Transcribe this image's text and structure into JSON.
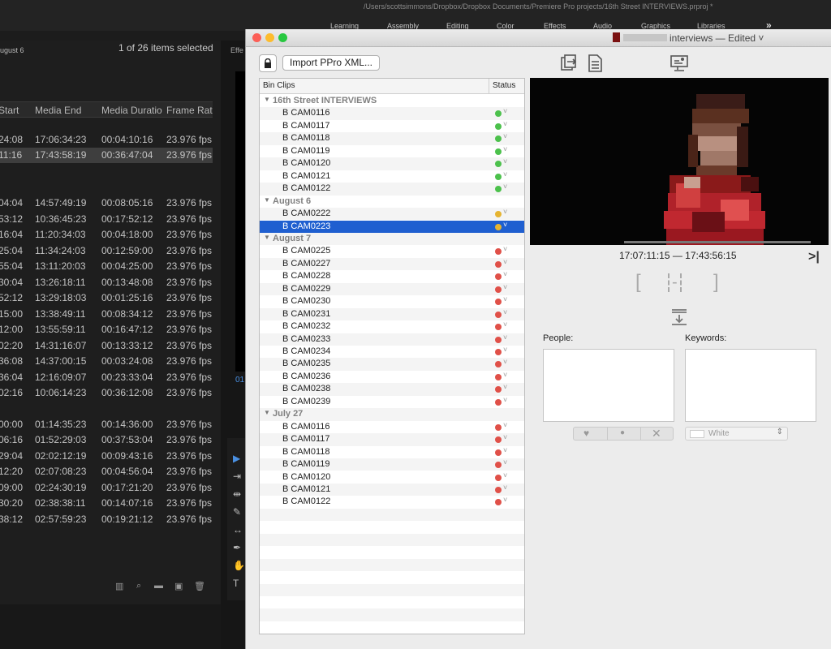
{
  "premiere": {
    "title_path": "/Users/scottsimmons/Dropbox/Dropbox Documents/Premiere Pro projects/16th Street INTERVIEWS.prproj *",
    "workspaces": [
      "Learning",
      "Assembly",
      "Editing",
      "Color",
      "Effects",
      "Audio",
      "Graphics",
      "Libraries"
    ],
    "more_label": "»",
    "panel_tab": "ugust 6",
    "selection_count": "1 of 26 items selected",
    "columns": [
      "Start",
      "Media End",
      "Media Duratio",
      "Frame Rat"
    ],
    "rows": [
      {
        "start": "24:08",
        "end": "17:06:34:23",
        "dur": "00:04:10:16",
        "fps": "23.976 fps"
      },
      {
        "start": "11:16",
        "end": "17:43:58:19",
        "dur": "00:36:47:04",
        "fps": "23.976 fps"
      },
      {
        "start": "04:04",
        "end": "14:57:49:19",
        "dur": "00:08:05:16",
        "fps": "23.976 fps"
      },
      {
        "start": "53:12",
        "end": "10:36:45:23",
        "dur": "00:17:52:12",
        "fps": "23.976 fps"
      },
      {
        "start": "16:04",
        "end": "11:20:34:03",
        "dur": "00:04:18:00",
        "fps": "23.976 fps"
      },
      {
        "start": "25:04",
        "end": "11:34:24:03",
        "dur": "00:12:59:00",
        "fps": "23.976 fps"
      },
      {
        "start": "55:04",
        "end": "13:11:20:03",
        "dur": "00:04:25:00",
        "fps": "23.976 fps"
      },
      {
        "start": "30:04",
        "end": "13:26:18:11",
        "dur": "00:13:48:08",
        "fps": "23.976 fps"
      },
      {
        "start": "52:12",
        "end": "13:29:18:03",
        "dur": "00:01:25:16",
        "fps": "23.976 fps"
      },
      {
        "start": "15:00",
        "end": "13:38:49:11",
        "dur": "00:08:34:12",
        "fps": "23.976 fps"
      },
      {
        "start": "12:00",
        "end": "13:55:59:11",
        "dur": "00:16:47:12",
        "fps": "23.976 fps"
      },
      {
        "start": "02:20",
        "end": "14:31:16:07",
        "dur": "00:13:33:12",
        "fps": "23.976 fps"
      },
      {
        "start": "36:08",
        "end": "14:37:00:15",
        "dur": "00:03:24:08",
        "fps": "23.976 fps"
      },
      {
        "start": "36:04",
        "end": "12:16:09:07",
        "dur": "00:23:33:04",
        "fps": "23.976 fps"
      },
      {
        "start": "02:16",
        "end": "10:06:14:23",
        "dur": "00:36:12:08",
        "fps": "23.976 fps"
      },
      {
        "start": "00:00",
        "end": "01:14:35:23",
        "dur": "00:14:36:00",
        "fps": "23.976 fps"
      },
      {
        "start": "06:16",
        "end": "01:52:29:03",
        "dur": "00:37:53:04",
        "fps": "23.976 fps"
      },
      {
        "start": "29:04",
        "end": "02:02:12:19",
        "dur": "00:09:43:16",
        "fps": "23.976 fps"
      },
      {
        "start": "12:20",
        "end": "02:07:08:23",
        "dur": "00:04:56:04",
        "fps": "23.976 fps"
      },
      {
        "start": "09:00",
        "end": "02:24:30:19",
        "dur": "00:17:21:20",
        "fps": "23.976 fps"
      },
      {
        "start": "30:20",
        "end": "02:38:38:11",
        "dur": "00:14:07:16",
        "fps": "23.976 fps"
      },
      {
        "start": "38:12",
        "end": "02:57:59:23",
        "dur": "00:19:21:12",
        "fps": "23.976 fps"
      }
    ],
    "effects_tab": "Effe",
    "timecode_fragment": "01"
  },
  "app": {
    "title": "interviews — Edited ˅",
    "import_label": "Import PPro XML...",
    "bin_header": "Bin Clips",
    "status_header": "Status",
    "status_colors": {
      "green": "#4cc14c",
      "yellow": "#e6b431",
      "red": "#e05048"
    },
    "groups": [
      {
        "name": "16th Street INTERVIEWS",
        "clips": [
          {
            "name": "B CAM0116",
            "status": "green"
          },
          {
            "name": "B CAM0117",
            "status": "green"
          },
          {
            "name": "B CAM0118",
            "status": "green"
          },
          {
            "name": "B CAM0119",
            "status": "green"
          },
          {
            "name": "B CAM0120",
            "status": "green"
          },
          {
            "name": "B CAM0121",
            "status": "green"
          },
          {
            "name": "B CAM0122",
            "status": "green"
          }
        ]
      },
      {
        "name": "August 6",
        "clips": [
          {
            "name": "B CAM0222",
            "status": "yellow"
          },
          {
            "name": "B CAM0223",
            "status": "yellow",
            "selected": true
          }
        ]
      },
      {
        "name": "August 7",
        "clips": [
          {
            "name": "B CAM0225",
            "status": "red"
          },
          {
            "name": "B CAM0227",
            "status": "red"
          },
          {
            "name": "B CAM0228",
            "status": "red"
          },
          {
            "name": "B CAM0229",
            "status": "red"
          },
          {
            "name": "B CAM0230",
            "status": "red"
          },
          {
            "name": "B CAM0231",
            "status": "red"
          },
          {
            "name": "B CAM0232",
            "status": "red"
          },
          {
            "name": "B CAM0233",
            "status": "red"
          },
          {
            "name": "B CAM0234",
            "status": "red"
          },
          {
            "name": "B CAM0235",
            "status": "red"
          },
          {
            "name": "B CAM0236",
            "status": "red"
          },
          {
            "name": "B CAM0238",
            "status": "red"
          },
          {
            "name": "B CAM0239",
            "status": "red"
          }
        ]
      },
      {
        "name": "July 27",
        "clips": [
          {
            "name": "B CAM0116",
            "status": "red"
          },
          {
            "name": "B CAM0117",
            "status": "red"
          },
          {
            "name": "B CAM0118",
            "status": "red"
          },
          {
            "name": "B CAM0119",
            "status": "red"
          },
          {
            "name": "B CAM0120",
            "status": "red"
          },
          {
            "name": "B CAM0121",
            "status": "red"
          },
          {
            "name": "B CAM0122",
            "status": "red"
          }
        ]
      }
    ],
    "timecode_range": "17:07:11:15 — 17:43:56:15",
    "people_label": "People:",
    "keywords_label": "Keywords:",
    "color_value": "White",
    "accent": "#1f5fd0"
  }
}
